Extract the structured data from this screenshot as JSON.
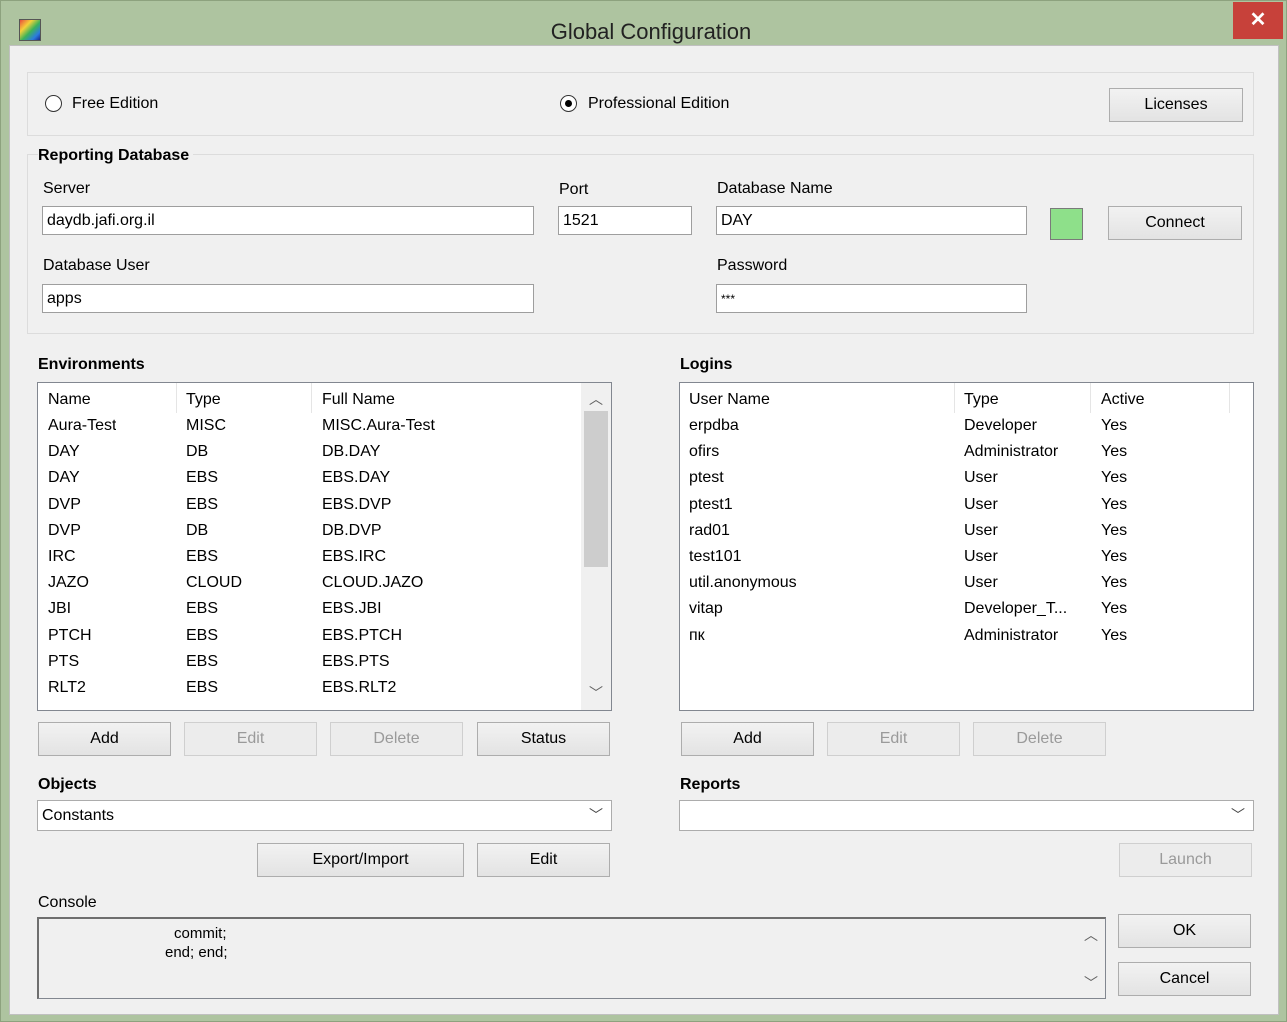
{
  "window": {
    "title": "Global Configuration",
    "close_glyph": "✕",
    "app_icon": "app-logo-icon"
  },
  "edition": {
    "free_label": "Free Edition",
    "pro_label": "Professional Edition",
    "selected": "Professional Edition",
    "licenses_label": "Licenses"
  },
  "reporting_db": {
    "heading": "Reporting Database",
    "server_label": "Server",
    "server_value": "daydb.jafi.org.il",
    "port_label": "Port",
    "port_value": "1521",
    "dbname_label": "Database Name",
    "dbname_value": "DAY",
    "user_label": "Database User",
    "user_value": "apps",
    "password_label": "Password",
    "password_value": "***",
    "status_color": "#8ee08a",
    "connect_label": "Connect"
  },
  "environments": {
    "heading": "Environments",
    "columns": [
      "Name",
      "Type",
      "Full Name"
    ],
    "rows": [
      [
        "Aura-Test",
        "MISC",
        "MISC.Aura-Test"
      ],
      [
        "DAY",
        "DB",
        "DB.DAY"
      ],
      [
        "DAY",
        "EBS",
        "EBS.DAY"
      ],
      [
        "DVP",
        "EBS",
        "EBS.DVP"
      ],
      [
        "DVP",
        "DB",
        "DB.DVP"
      ],
      [
        "IRC",
        "EBS",
        "EBS.IRC"
      ],
      [
        "JAZO",
        "CLOUD",
        "CLOUD.JAZO"
      ],
      [
        "JBI",
        "EBS",
        "EBS.JBI"
      ],
      [
        "PTCH",
        "EBS",
        "EBS.PTCH"
      ],
      [
        "PTS",
        "EBS",
        "EBS.PTS"
      ],
      [
        "RLT2",
        "EBS",
        "EBS.RLT2"
      ]
    ],
    "add_label": "Add",
    "edit_label": "Edit",
    "delete_label": "Delete",
    "status_label": "Status"
  },
  "logins": {
    "heading": "Logins",
    "columns": [
      "User Name",
      "Type",
      "Active"
    ],
    "rows": [
      [
        "erpdba",
        "Developer",
        "Yes"
      ],
      [
        "ofirs",
        "Administrator",
        "Yes"
      ],
      [
        "ptest",
        "User",
        "Yes"
      ],
      [
        "ptest1",
        "User",
        "Yes"
      ],
      [
        "rad01",
        "User",
        "Yes"
      ],
      [
        "test101",
        "User",
        "Yes"
      ],
      [
        "util.anonymous",
        "User",
        "Yes"
      ],
      [
        "vitap",
        "Developer_T...",
        "Yes"
      ],
      [
        "пк",
        "Administrator",
        "Yes"
      ]
    ],
    "add_label": "Add",
    "edit_label": "Edit",
    "delete_label": "Delete"
  },
  "objects": {
    "heading": "Objects",
    "selected": "Constants",
    "export_label": "Export/Import",
    "edit_label": "Edit"
  },
  "reports": {
    "heading": "Reports",
    "selected": "",
    "launch_label": "Launch"
  },
  "console": {
    "label": "Console",
    "line1": "commit;",
    "line2": "end; end;"
  },
  "dialog": {
    "ok_label": "OK",
    "cancel_label": "Cancel"
  }
}
